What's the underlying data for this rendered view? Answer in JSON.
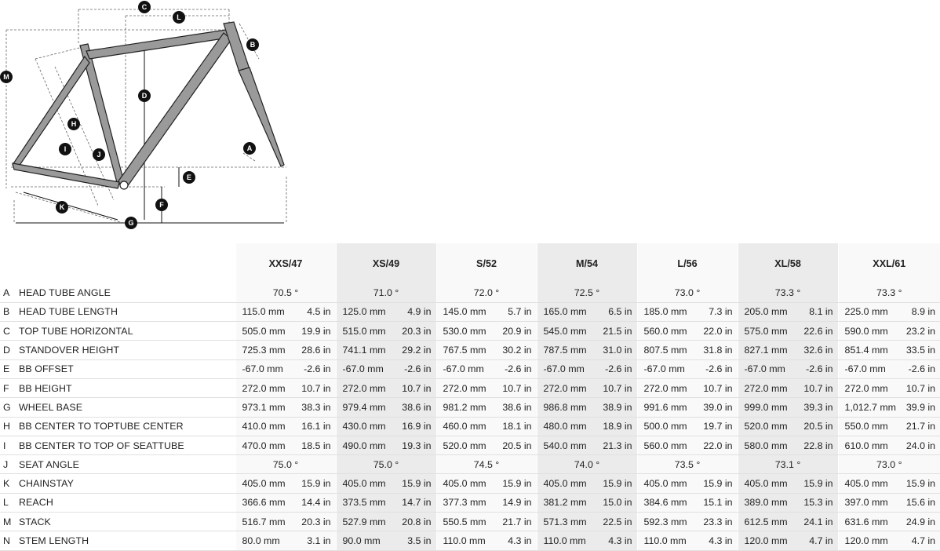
{
  "diagram": {
    "markers": [
      "A",
      "B",
      "C",
      "D",
      "E",
      "F",
      "G",
      "H",
      "I",
      "J",
      "K",
      "L",
      "M"
    ]
  },
  "sizes": [
    "XXS/47",
    "XS/49",
    "S/52",
    "M/54",
    "L/56",
    "XL/58",
    "XXL/61"
  ],
  "rows": [
    {
      "letter": "A",
      "label": "HEAD TUBE ANGLE",
      "values": [
        "70.5 °",
        "71.0 °",
        "72.0 °",
        "72.5 °",
        "73.0 °",
        "73.3 °",
        "73.3 °"
      ]
    },
    {
      "letter": "B",
      "label": "HEAD TUBE LENGTH",
      "mm": [
        "115.0 mm",
        "125.0 mm",
        "145.0 mm",
        "165.0 mm",
        "185.0 mm",
        "205.0 mm",
        "225.0 mm"
      ],
      "in": [
        "4.5 in",
        "4.9 in",
        "5.7 in",
        "6.5 in",
        "7.3 in",
        "8.1 in",
        "8.9 in"
      ]
    },
    {
      "letter": "C",
      "label": "TOP TUBE HORIZONTAL",
      "mm": [
        "505.0 mm",
        "515.0 mm",
        "530.0 mm",
        "545.0 mm",
        "560.0 mm",
        "575.0 mm",
        "590.0 mm"
      ],
      "in": [
        "19.9 in",
        "20.3 in",
        "20.9 in",
        "21.5 in",
        "22.0 in",
        "22.6 in",
        "23.2 in"
      ]
    },
    {
      "letter": "D",
      "label": "STANDOVER HEIGHT",
      "mm": [
        "725.3 mm",
        "741.1 mm",
        "767.5 mm",
        "787.5 mm",
        "807.5 mm",
        "827.1 mm",
        "851.4 mm"
      ],
      "in": [
        "28.6 in",
        "29.2 in",
        "30.2 in",
        "31.0 in",
        "31.8 in",
        "32.6 in",
        "33.5 in"
      ]
    },
    {
      "letter": "E",
      "label": "BB OFFSET",
      "mm": [
        "-67.0 mm",
        "-67.0 mm",
        "-67.0 mm",
        "-67.0 mm",
        "-67.0 mm",
        "-67.0 mm",
        "-67.0 mm"
      ],
      "in": [
        "-2.6 in",
        "-2.6 in",
        "-2.6 in",
        "-2.6 in",
        "-2.6 in",
        "-2.6 in",
        "-2.6 in"
      ]
    },
    {
      "letter": "F",
      "label": "BB HEIGHT",
      "mm": [
        "272.0 mm",
        "272.0 mm",
        "272.0 mm",
        "272.0 mm",
        "272.0 mm",
        "272.0 mm",
        "272.0 mm"
      ],
      "in": [
        "10.7 in",
        "10.7 in",
        "10.7 in",
        "10.7 in",
        "10.7 in",
        "10.7 in",
        "10.7 in"
      ]
    },
    {
      "letter": "G",
      "label": "WHEEL BASE",
      "mm": [
        "973.1 mm",
        "979.4 mm",
        "981.2 mm",
        "986.8 mm",
        "991.6 mm",
        "999.0 mm",
        "1,012.7 mm"
      ],
      "in": [
        "38.3 in",
        "38.6 in",
        "38.6 in",
        "38.9 in",
        "39.0 in",
        "39.3 in",
        "39.9 in"
      ]
    },
    {
      "letter": "H",
      "label": "BB CENTER TO TOPTUBE CENTER",
      "mm": [
        "410.0 mm",
        "430.0 mm",
        "460.0 mm",
        "480.0 mm",
        "500.0 mm",
        "520.0 mm",
        "550.0 mm"
      ],
      "in": [
        "16.1 in",
        "16.9 in",
        "18.1 in",
        "18.9 in",
        "19.7 in",
        "20.5 in",
        "21.7 in"
      ]
    },
    {
      "letter": "I",
      "label": "BB CENTER TO TOP OF SEATTUBE",
      "mm": [
        "470.0 mm",
        "490.0 mm",
        "520.0 mm",
        "540.0 mm",
        "560.0 mm",
        "580.0 mm",
        "610.0 mm"
      ],
      "in": [
        "18.5 in",
        "19.3 in",
        "20.5 in",
        "21.3 in",
        "22.0 in",
        "22.8 in",
        "24.0 in"
      ]
    },
    {
      "letter": "J",
      "label": "SEAT ANGLE",
      "values": [
        "75.0 °",
        "75.0 °",
        "74.5 °",
        "74.0 °",
        "73.5 °",
        "73.1 °",
        "73.0 °"
      ]
    },
    {
      "letter": "K",
      "label": "CHAINSTAY",
      "mm": [
        "405.0 mm",
        "405.0 mm",
        "405.0 mm",
        "405.0 mm",
        "405.0 mm",
        "405.0 mm",
        "405.0 mm"
      ],
      "in": [
        "15.9 in",
        "15.9 in",
        "15.9 in",
        "15.9 in",
        "15.9 in",
        "15.9 in",
        "15.9 in"
      ]
    },
    {
      "letter": "L",
      "label": "REACH",
      "mm": [
        "366.6 mm",
        "373.5 mm",
        "377.3 mm",
        "381.2 mm",
        "384.6 mm",
        "389.0 mm",
        "397.0 mm"
      ],
      "in": [
        "14.4 in",
        "14.7 in",
        "14.9 in",
        "15.0 in",
        "15.1 in",
        "15.3 in",
        "15.6 in"
      ]
    },
    {
      "letter": "M",
      "label": "STACK",
      "mm": [
        "516.7 mm",
        "527.9 mm",
        "550.5 mm",
        "571.3 mm",
        "592.3 mm",
        "612.5 mm",
        "631.6 mm"
      ],
      "in": [
        "20.3 in",
        "20.8 in",
        "21.7 in",
        "22.5 in",
        "23.3 in",
        "24.1 in",
        "24.9 in"
      ]
    },
    {
      "letter": "N",
      "label": "STEM LENGTH",
      "mm": [
        "80.0 mm",
        "90.0 mm",
        "110.0 mm",
        "110.0 mm",
        "110.0 mm",
        "120.0 mm",
        "120.0 mm"
      ],
      "in": [
        "3.1 in",
        "3.5 in",
        "4.3 in",
        "4.3 in",
        "4.3 in",
        "4.7 in",
        "4.7 in"
      ]
    }
  ]
}
